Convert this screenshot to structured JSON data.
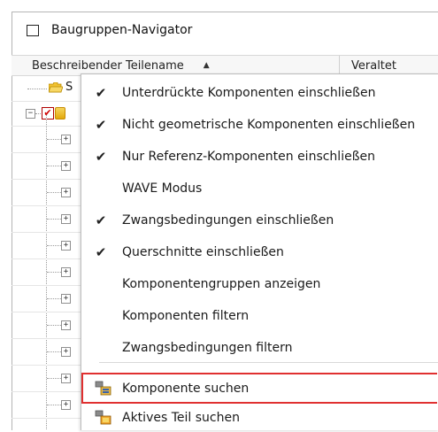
{
  "panel": {
    "title": "Baugruppen-Navigator",
    "columns": {
      "name_header": "Beschreibender Teilename",
      "sort_indicator": "▲",
      "status_header": "Veraltet"
    }
  },
  "menu": {
    "items": [
      {
        "label": "Unterdrückte Komponenten einschließen",
        "checked": true,
        "check_glyph": "✔"
      },
      {
        "label": "Nicht geometrische Komponenten einschließen",
        "checked": true,
        "check_glyph": "✔"
      },
      {
        "label": "Nur Referenz-Komponenten einschließen",
        "checked": true,
        "check_glyph": "✔"
      },
      {
        "label": "WAVE Modus",
        "checked": false,
        "check_glyph": ""
      },
      {
        "label": "Zwangsbedingungen einschließen",
        "checked": true,
        "check_glyph": "✔"
      },
      {
        "label": "Querschnitte einschließen",
        "checked": true,
        "check_glyph": "✔"
      },
      {
        "label": "Komponentengruppen anzeigen",
        "checked": false,
        "check_glyph": ""
      },
      {
        "label": "Komponenten filtern",
        "checked": false,
        "check_glyph": ""
      },
      {
        "label": "Zwangsbedingungen filtern",
        "checked": false,
        "check_glyph": ""
      },
      {
        "label": "Komponente suchen",
        "icon": "find-component-icon",
        "highlighted": true
      },
      {
        "label": "Aktives Teil suchen",
        "icon": "find-active-part-icon"
      }
    ]
  },
  "tree": {
    "root_partial_label": "S",
    "expander_glyph": "+",
    "collapse_glyph": "−",
    "check_glyph": "✔"
  },
  "colors": {
    "highlight_border": "#e03030",
    "check_red": "#d00000",
    "folder_yellow": "#f1c232"
  }
}
